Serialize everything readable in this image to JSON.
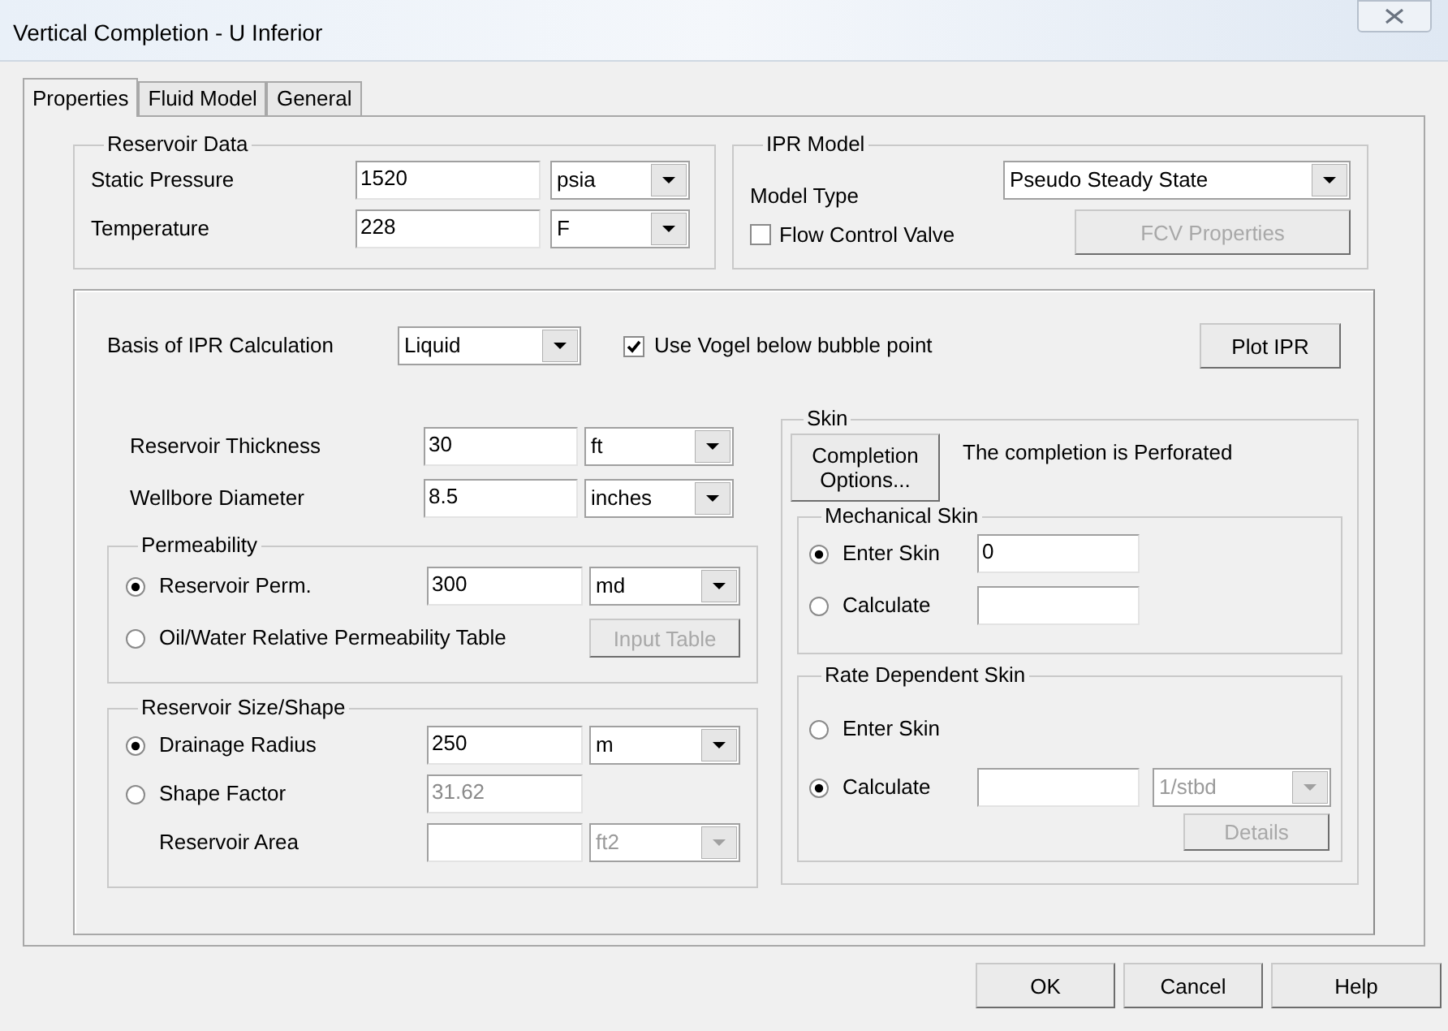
{
  "window": {
    "title": "Vertical Completion - U Inferior"
  },
  "tabs": [
    {
      "label": "Properties",
      "selected": true
    },
    {
      "label": "Fluid Model",
      "selected": false
    },
    {
      "label": "General",
      "selected": false
    }
  ],
  "reservoir_data": {
    "title": "Reservoir Data",
    "rows": [
      {
        "label": "Static Pressure",
        "value": "1520",
        "unit": "psia"
      },
      {
        "label": "Temperature",
        "value": "228",
        "unit": "F"
      }
    ]
  },
  "ipr_model": {
    "title": "IPR Model",
    "model_type_label": "Model Type",
    "model_type": "Pseudo Steady State",
    "flow_control_valve": {
      "label": "Flow Control Valve",
      "checked": false
    },
    "fcv_button": {
      "label": "FCV Properties",
      "disabled": true
    }
  },
  "basis": {
    "label": "Basis of IPR Calculation",
    "value": "Liquid"
  },
  "vogel": {
    "label": "Use Vogel below bubble point",
    "checked": true
  },
  "plot_button": {
    "label": "Plot IPR"
  },
  "geometry": [
    {
      "label": "Reservoir Thickness",
      "value": "30",
      "unit": "ft"
    },
    {
      "label": "Wellbore Diameter",
      "value": "8.5",
      "unit": "inches"
    }
  ],
  "permeability": {
    "title": "Permeability",
    "options": [
      {
        "label": "Reservoir Perm.",
        "selected": true,
        "value": "300",
        "unit": "md"
      },
      {
        "label": "Oil/Water Relative Permeability Table",
        "selected": false
      }
    ],
    "input_table_button": {
      "label": "Input Table",
      "disabled": true
    }
  },
  "size_shape": {
    "title": "Reservoir Size/Shape",
    "options": [
      {
        "label": "Drainage Radius",
        "selected": true,
        "value": "250",
        "value_disabled": false,
        "unit": "m"
      },
      {
        "label": "Shape Factor",
        "selected": false,
        "value": "31.62",
        "value_disabled": true
      }
    ],
    "area": {
      "label": "Reservoir Area",
      "unit": "ft2",
      "disabled": true
    }
  },
  "skin": {
    "title": "Skin",
    "completion_button": "Completion Options...",
    "status": "The completion is Perforated",
    "mechanical": {
      "title": "Mechanical Skin",
      "options": [
        {
          "label": "Enter Skin",
          "selected": true,
          "value": "0"
        },
        {
          "label": "Calculate",
          "selected": false
        }
      ]
    },
    "rate_dependent": {
      "title": "Rate Dependent Skin",
      "options": [
        {
          "label": "Enter Skin",
          "selected": false
        },
        {
          "label": "Calculate",
          "selected": true
        }
      ],
      "unit": {
        "value": "1/stbd",
        "disabled": true
      },
      "details_button": {
        "label": "Details",
        "disabled": true
      }
    }
  },
  "buttons": [
    "OK",
    "Cancel",
    "Help"
  ]
}
